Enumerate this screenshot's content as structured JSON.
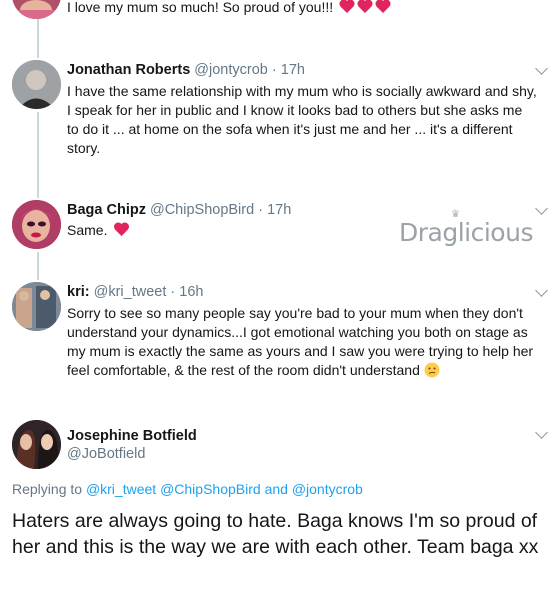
{
  "tweets": [
    {
      "name": "",
      "handle": "",
      "time": "",
      "text": "I love my mum so much! So proud of you!!!"
    },
    {
      "name": "Jonathan Roberts",
      "handle": "@jontycrob",
      "time": "17h",
      "text": "I have the same relationship with my mum who is socially awkward and shy, I speak for her in public and I know it looks bad to others but she asks me to do it ... at home on the sofa when it's just me and her ... it's a different story."
    },
    {
      "name": "Baga Chipz",
      "handle": "@ChipShopBird",
      "time": "17h",
      "text": "Same."
    },
    {
      "name": "kri:",
      "handle": "@kri_tweet",
      "time": "16h",
      "text": "Sorry to see so many people say you're bad to your mum when they don't understand your dynamics...I got emotional watching you both on stage as my mum is exactly the same as yours and I saw you were trying to help her feel comfortable, & the rest of the room didn't understand"
    }
  ],
  "focus": {
    "name": "Josephine Botfield",
    "handle": "@JoBotfield",
    "replying_prefix": "Replying to",
    "mention1": "@kri_tweet",
    "mention2": "@ChipShopBird",
    "and_word": "and",
    "mention3": "@jontycrob",
    "text": "Haters are always going to hate. Baga knows I'm so proud of her and this is the way we are with each other. Team baga xx"
  },
  "watermark": "Draglicious",
  "dot": "·",
  "icons": [
    "heart-emoji-icon",
    "confused-face-emoji-icon",
    "chevron-down-icon",
    "crown-icon"
  ],
  "colors": {
    "link": "#1da1f2",
    "meta": "#657786",
    "thread_line": "#ccd6dd",
    "heart": "#e0245e"
  }
}
